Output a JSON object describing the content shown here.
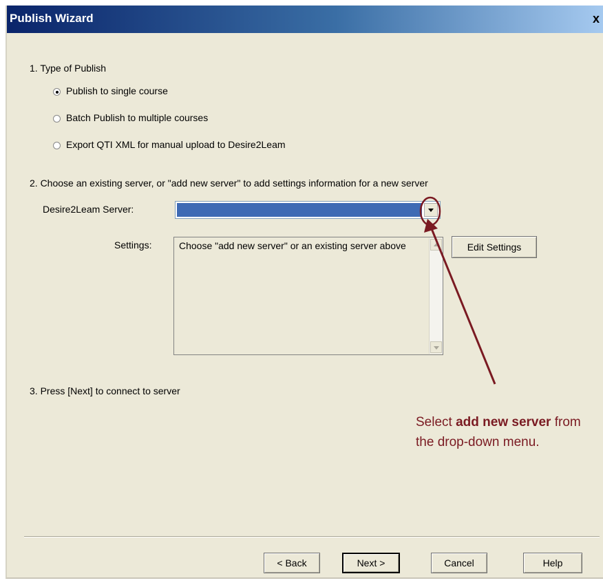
{
  "window": {
    "title": "Publish Wizard",
    "close_glyph": "x"
  },
  "step1": {
    "heading": "1.  Type of Publish",
    "options": [
      {
        "label": "Publish to single course",
        "selected": true
      },
      {
        "label": "Batch Publish to multiple courses",
        "selected": false
      },
      {
        "label": "Export QTI XML for manual upload to Desire2Leam",
        "selected": false
      }
    ]
  },
  "step2": {
    "heading": "2.  Choose an existing server, or \"add new server\" to add settings information for a new server",
    "server_label": "Desire2Leam Server:",
    "server_value": "",
    "settings_label": "Settings:",
    "settings_text": "Choose \"add new server\" or an existing server above",
    "edit_settings_button": "Edit Settings"
  },
  "step3": {
    "heading": "3.  Press [Next] to connect to server"
  },
  "annotation": {
    "text_1": "Select ",
    "bold_1": "add new server",
    "text_2": " from the drop-down menu.",
    "color": "#7a1a22"
  },
  "footer": {
    "back": "< Back",
    "next": "Next >",
    "cancel": "Cancel",
    "help": "Help"
  },
  "colors": {
    "titlebar_start": "#0a246a",
    "titlebar_end": "#a6caf0",
    "dialog_bg": "#ece9d8",
    "combo_selection": "#3e6ab4"
  }
}
